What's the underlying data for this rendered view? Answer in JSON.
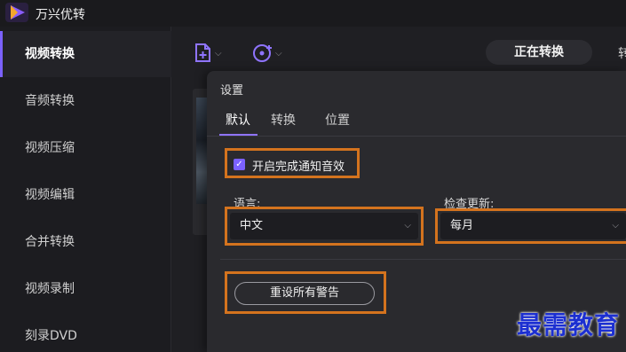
{
  "app": {
    "title": "万兴优转",
    "logo_icon": "play-logo-icon",
    "accent": "#7b61ff"
  },
  "sidebar": {
    "items": [
      {
        "label": "视频转换",
        "active": true
      },
      {
        "label": "音频转换"
      },
      {
        "label": "视频压缩"
      },
      {
        "label": "视频编辑"
      },
      {
        "label": "合并转换"
      },
      {
        "label": "视频录制"
      },
      {
        "label": "刻录DVD"
      }
    ]
  },
  "toolbar": {
    "add_file_icon": "add-file-icon",
    "add_disc_icon": "add-disc-icon",
    "segment_active": "正在转换",
    "segment_next": "转"
  },
  "dialog": {
    "title": "设置",
    "tabs": [
      {
        "label": "默认",
        "active": true
      },
      {
        "label": "转换"
      },
      {
        "label": "位置"
      }
    ],
    "notify_checkbox": {
      "label": "开启完成通知音效",
      "checked": true
    },
    "language": {
      "label": "语言:",
      "value": "中文"
    },
    "update": {
      "label": "检查更新:",
      "value": "每月"
    },
    "reset_button": "重设所有警告"
  },
  "highlight_color": "#d4731e",
  "watermark": "最需教育"
}
